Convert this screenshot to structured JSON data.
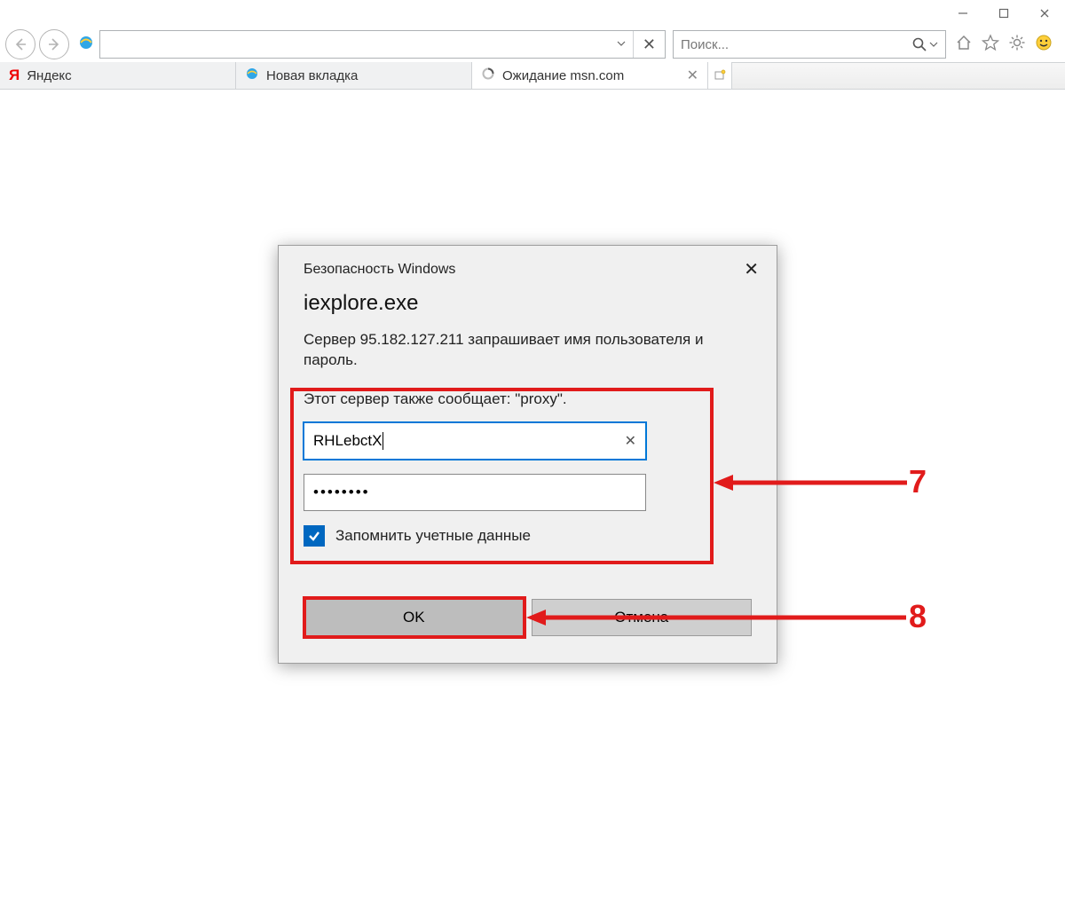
{
  "tabs": [
    {
      "label": "Яндекс"
    },
    {
      "label": "Новая вкладка"
    },
    {
      "label": "Ожидание msn.com"
    }
  ],
  "search": {
    "placeholder": "Поиск..."
  },
  "dialog": {
    "title": "Безопасность Windows",
    "app": "iexplore.exe",
    "desc": "Сервер 95.182.127.211 запрашивает имя пользователя и пароль.",
    "realm": "Этот сервер также сообщает: \"proxy\".",
    "username": "RHLebctX",
    "password_mask": "••••••••",
    "remember": "Запомнить учетные данные",
    "ok": "OK",
    "cancel": "Отмена"
  },
  "annotations": {
    "r1": "7",
    "r2": "8"
  }
}
